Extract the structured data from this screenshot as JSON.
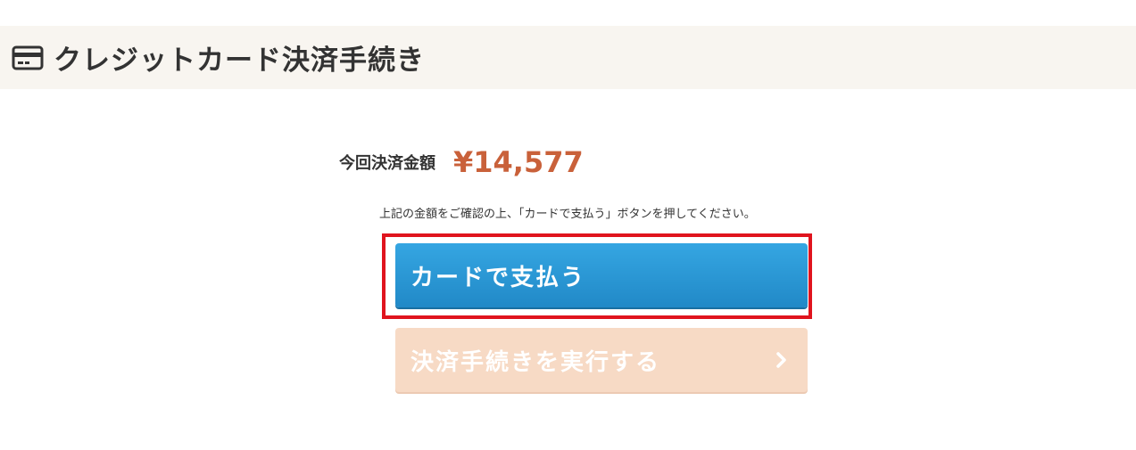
{
  "header": {
    "icon": "credit-card-icon",
    "title": "クレジットカード決済手続き"
  },
  "payment": {
    "amount_label": "今回決済金額",
    "amount_value": "¥14,577",
    "amount_color": "#c9613a",
    "instruction": "上記の金額をご確認の上、「カードで支払う」ボタンを押してください。"
  },
  "buttons": {
    "pay_card_label": "カードで支払う",
    "pay_card_color": "#2f9bd8",
    "execute_label": "決済手続きを実行する",
    "execute_color": "#f7dac5",
    "execute_icon": "chevron-right-icon"
  },
  "highlight_color": "#e0141e"
}
